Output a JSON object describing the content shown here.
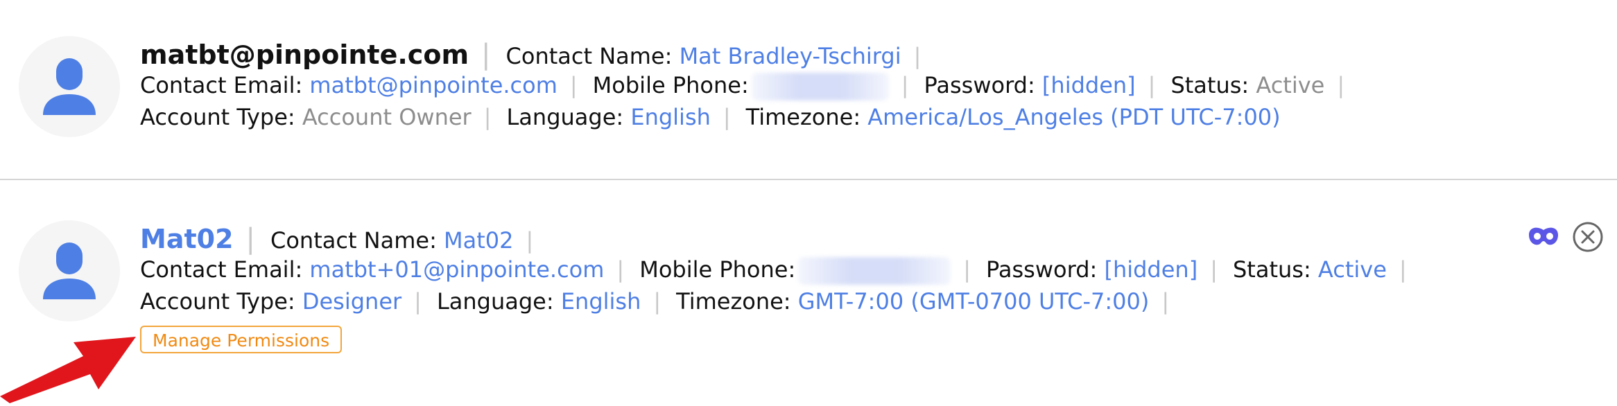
{
  "users": [
    {
      "username": "matbt@pinpointe.com",
      "contact_name_label": "Contact Name:",
      "contact_name": "Mat Bradley-Tschirgi",
      "contact_email_label": "Contact Email:",
      "contact_email": "matbt@pinpointe.com",
      "mobile_phone_label": "Mobile Phone:",
      "password_label": "Password:",
      "password": "[hidden]",
      "status_label": "Status:",
      "status": "Active",
      "account_type_label": "Account Type:",
      "account_type": "Account Owner",
      "language_label": "Language:",
      "language": "English",
      "timezone_label": "Timezone:",
      "timezone": "America/Los_Angeles (PDT UTC-7:00)"
    },
    {
      "username": "Mat02",
      "contact_name_label": "Contact Name:",
      "contact_name": "Mat02",
      "contact_email_label": "Contact Email:",
      "contact_email": "matbt+01@pinpointe.com",
      "mobile_phone_label": "Mobile Phone:",
      "password_label": "Password:",
      "password": "[hidden]",
      "status_label": "Status:",
      "status": "Active",
      "account_type_label": "Account Type:",
      "account_type": "Designer",
      "language_label": "Language:",
      "language": "English",
      "timezone_label": "Timezone:",
      "timezone": "GMT-7:00 (GMT-0700 UTC-7:00)",
      "manage_permissions": "Manage Permissions"
    }
  ],
  "separator": "|",
  "icons": {
    "avatar": "user-avatar-icon",
    "impersonate": "mask-icon",
    "delete": "close-circle-icon",
    "annotation": "red-arrow"
  },
  "colors": {
    "link": "#4e7fe4",
    "muted": "#8d8d8d",
    "avatar": "#4e7fe4",
    "manage_button": "#f08a13",
    "arrow": "#e0161c"
  }
}
